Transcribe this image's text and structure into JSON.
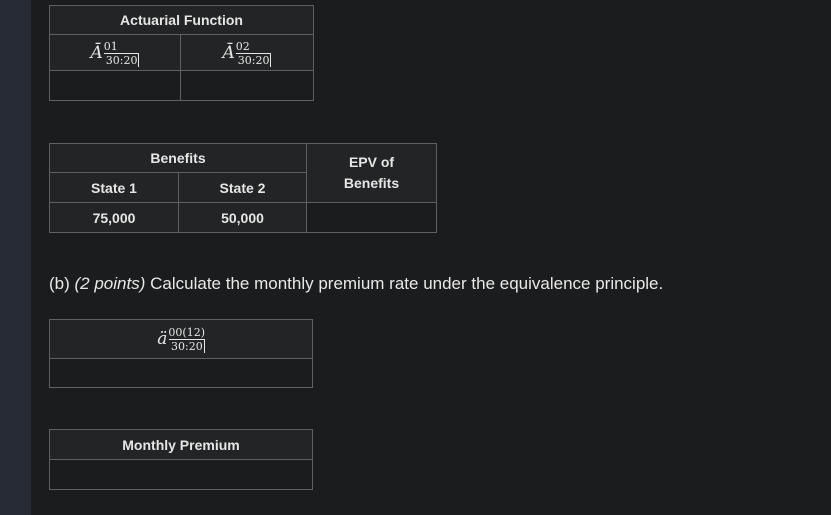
{
  "table1": {
    "header": "Actuarial Function",
    "col1": {
      "base": "Ā",
      "sup": "01",
      "sub": "30:20"
    },
    "col2": {
      "base": "Ā",
      "sup": "02",
      "sub": "30:20"
    }
  },
  "table2": {
    "header_benefits": "Benefits",
    "header_epv": "EPV of Benefits",
    "state1_label": "State 1",
    "state2_label": "State 2",
    "state1_value": "75,000",
    "state2_value": "50,000"
  },
  "part_b": {
    "label": "(b)",
    "points": "(2 points)",
    "text": "Calculate the monthly premium rate under the equivalence principle."
  },
  "table3": {
    "symbol": {
      "base": "ä",
      "sup": "00(12)",
      "sub": "30:20"
    }
  },
  "table4": {
    "header": "Monthly Premium"
  }
}
